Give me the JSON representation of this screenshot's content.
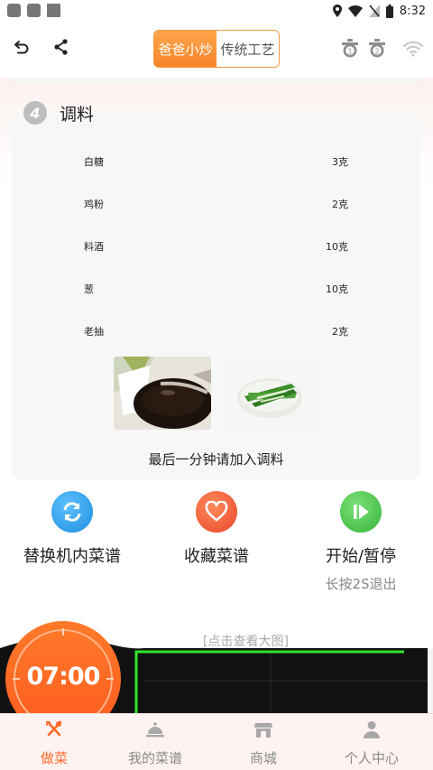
{
  "status_bar": {
    "time": "8:32"
  },
  "header": {
    "mode_tabs": [
      {
        "label": "爸爸小炒",
        "active": true
      },
      {
        "label": "传统工艺",
        "active": false
      }
    ],
    "pot_1_label": "1",
    "pot_2_label": "2"
  },
  "section": {
    "step_number": "4",
    "title": "调料"
  },
  "ingredients": [
    {
      "name": "白糖",
      "qty": "3克"
    },
    {
      "name": "鸡粉",
      "qty": "2克"
    },
    {
      "name": "料酒",
      "qty": "10克"
    },
    {
      "name": "葱",
      "qty": "10克"
    },
    {
      "name": "老抽",
      "qty": "2克"
    }
  ],
  "seasoning_note": "最后一分钟请加入调料",
  "actions": [
    {
      "label": "替换机内菜谱",
      "sub": ""
    },
    {
      "label": "收藏菜谱",
      "sub": ""
    },
    {
      "label": "开始/暂停",
      "sub": "长按2S退出"
    }
  ],
  "curve": {
    "view_large_link": "[点击查看大图]"
  },
  "timer": {
    "time": "07:00"
  },
  "bottom_nav": [
    {
      "label": "做菜",
      "active": true
    },
    {
      "label": "我的菜谱",
      "active": false
    },
    {
      "label": "商城",
      "active": false
    },
    {
      "label": "个人中心",
      "active": false
    }
  ],
  "colors": {
    "accent": "#ff6a2a",
    "refresh_button": "#3aa4e8",
    "favorite_button": "#f05a3a",
    "start_button": "#4fc84f",
    "curve_line": "#2fe52f"
  }
}
